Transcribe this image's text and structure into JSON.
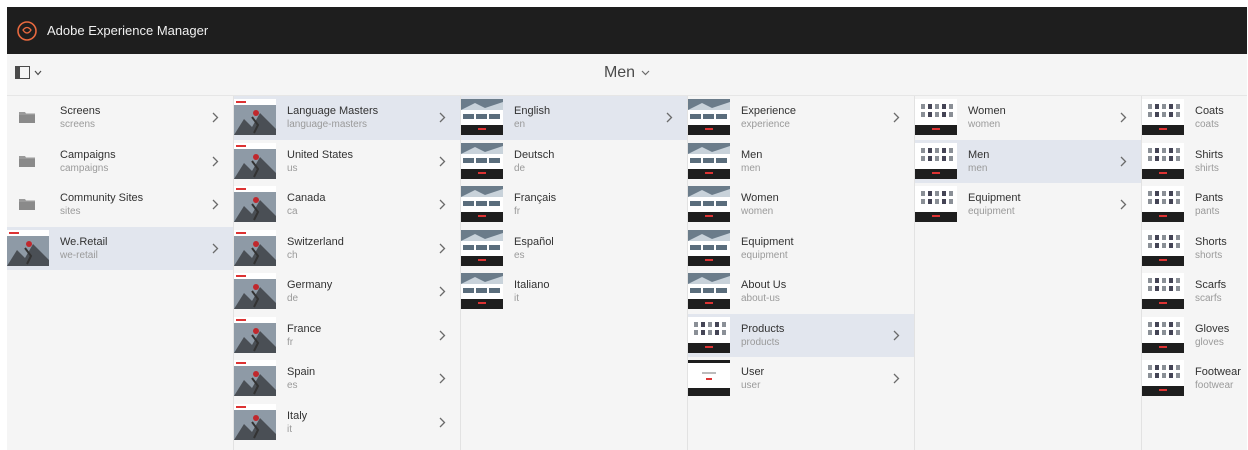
{
  "app": {
    "title": "Adobe Experience Manager"
  },
  "header": {
    "title": "Men"
  },
  "columns": [
    {
      "items": [
        {
          "name": "Screens",
          "path": "screens",
          "thumb": "folder",
          "chevron": true,
          "active": false
        },
        {
          "name": "Campaigns",
          "path": "campaigns",
          "thumb": "folder",
          "chevron": true,
          "active": false
        },
        {
          "name": "Community Sites",
          "path": "sites",
          "thumb": "folder",
          "chevron": true,
          "active": false
        },
        {
          "name": "We.Retail",
          "path": "we-retail",
          "thumb": "photo",
          "chevron": true,
          "active": true
        }
      ]
    },
    {
      "items": [
        {
          "name": "Language Masters",
          "path": "language-masters",
          "thumb": "photo",
          "chevron": true,
          "active": true
        },
        {
          "name": "United States",
          "path": "us",
          "thumb": "photo",
          "chevron": true,
          "active": false
        },
        {
          "name": "Canada",
          "path": "ca",
          "thumb": "photo",
          "chevron": true,
          "active": false
        },
        {
          "name": "Switzerland",
          "path": "ch",
          "thumb": "photo",
          "chevron": true,
          "active": false
        },
        {
          "name": "Germany",
          "path": "de",
          "thumb": "photo",
          "chevron": true,
          "active": false
        },
        {
          "name": "France",
          "path": "fr",
          "thumb": "photo",
          "chevron": true,
          "active": false
        },
        {
          "name": "Spain",
          "path": "es",
          "thumb": "photo",
          "chevron": true,
          "active": false
        },
        {
          "name": "Italy",
          "path": "it",
          "thumb": "photo",
          "chevron": true,
          "active": false
        }
      ]
    },
    {
      "items": [
        {
          "name": "English",
          "path": "en",
          "thumb": "page",
          "chevron": true,
          "active": true
        },
        {
          "name": "Deutsch",
          "path": "de",
          "thumb": "page",
          "chevron": false,
          "active": false
        },
        {
          "name": "Français",
          "path": "fr",
          "thumb": "page",
          "chevron": false,
          "active": false
        },
        {
          "name": "Español",
          "path": "es",
          "thumb": "page",
          "chevron": false,
          "active": false
        },
        {
          "name": "Italiano",
          "path": "it",
          "thumb": "page",
          "chevron": false,
          "active": false
        }
      ]
    },
    {
      "items": [
        {
          "name": "Experience",
          "path": "experience",
          "thumb": "page",
          "chevron": true,
          "active": false
        },
        {
          "name": "Men",
          "path": "men",
          "thumb": "page",
          "chevron": false,
          "active": false
        },
        {
          "name": "Women",
          "path": "women",
          "thumb": "page",
          "chevron": false,
          "active": false
        },
        {
          "name": "Equipment",
          "path": "equipment",
          "thumb": "page",
          "chevron": false,
          "active": false
        },
        {
          "name": "About Us",
          "path": "about-us",
          "thumb": "page",
          "chevron": false,
          "active": false
        },
        {
          "name": "Products",
          "path": "products",
          "thumb": "product",
          "chevron": true,
          "active": true
        },
        {
          "name": "User",
          "path": "user",
          "thumb": "user",
          "chevron": true,
          "active": false
        }
      ]
    },
    {
      "items": [
        {
          "name": "Women",
          "path": "women",
          "thumb": "product",
          "chevron": true,
          "active": false
        },
        {
          "name": "Men",
          "path": "men",
          "thumb": "product",
          "chevron": true,
          "active": true
        },
        {
          "name": "Equipment",
          "path": "equipment",
          "thumb": "product",
          "chevron": true,
          "active": false
        }
      ]
    },
    {
      "items": [
        {
          "name": "Coats",
          "path": "coats",
          "thumb": "product",
          "chevron": false,
          "active": false
        },
        {
          "name": "Shirts",
          "path": "shirts",
          "thumb": "product",
          "chevron": false,
          "active": false
        },
        {
          "name": "Pants",
          "path": "pants",
          "thumb": "product",
          "chevron": false,
          "active": false
        },
        {
          "name": "Shorts",
          "path": "shorts",
          "thumb": "product",
          "chevron": false,
          "active": false
        },
        {
          "name": "Scarfs",
          "path": "scarfs",
          "thumb": "product",
          "chevron": false,
          "active": false
        },
        {
          "name": "Gloves",
          "path": "gloves",
          "thumb": "product",
          "chevron": false,
          "active": false
        },
        {
          "name": "Footwear",
          "path": "footwear",
          "thumb": "product",
          "chevron": false,
          "active": false
        }
      ]
    }
  ],
  "icons": {
    "logo": "adobe-experience-manager-logo",
    "rail": "rail-toggle-icon",
    "caret": "chevron-down-icon",
    "folder": "folder-icon",
    "chevron": "chevron-right-icon"
  },
  "colors": {
    "topbar": "#1e1e1e",
    "logo": "#e8693f",
    "selected_row": "#e2e6ee",
    "page_bg": "#f5f5f5"
  }
}
